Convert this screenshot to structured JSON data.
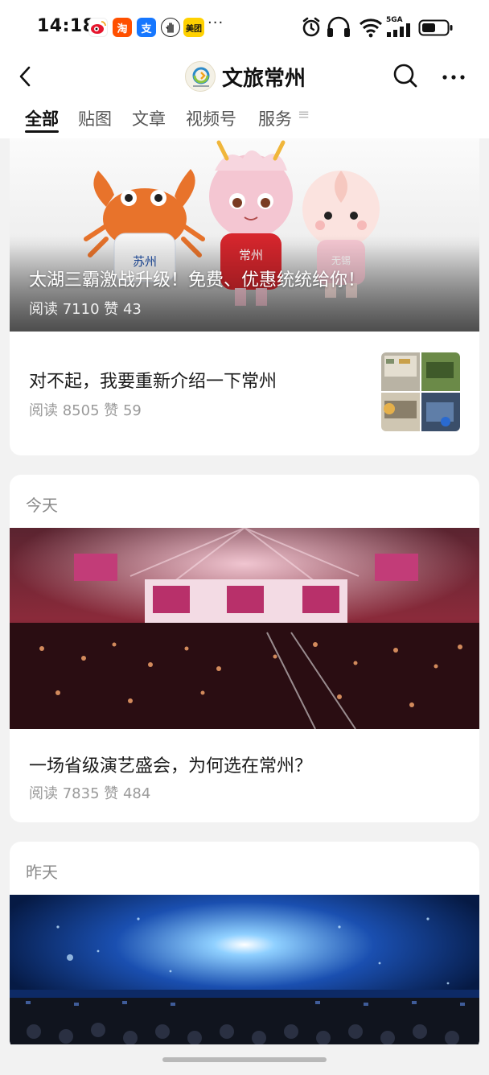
{
  "status_bar": {
    "time": "14:18",
    "app_icons": [
      {
        "name": "weibo-icon",
        "glyph": "微",
        "color": "#e6162d"
      },
      {
        "name": "taobao-icon",
        "glyph": "淘",
        "color": "#ff5000"
      },
      {
        "name": "alipay-icon",
        "glyph": "支",
        "color": "#1677ff"
      },
      {
        "name": "hand-icon",
        "glyph": "✋",
        "color": "#222222"
      },
      {
        "name": "meituan-icon",
        "glyph": "美团",
        "color": "#ffd100"
      }
    ],
    "more": "···",
    "network": "5GA"
  },
  "nav": {
    "title": "文旅常州",
    "avatar_icon": "wenlv-changzhou-logo"
  },
  "tabs": {
    "items": [
      "全部",
      "贴图",
      "文章",
      "视频号",
      "服务"
    ],
    "active_index": 0
  },
  "feed": {
    "hero": {
      "title": "太湖三霸激战升级！免费、优惠统统给你！",
      "meta": "阅读 7110   赞 43",
      "badges": [
        "苏州",
        "常州",
        "无锡"
      ]
    },
    "row": {
      "title": "对不起，我要重新介绍一下常州",
      "meta": "阅读 8505   赞 59"
    },
    "today": {
      "label": "今天",
      "title": "一场省级演艺盛会，为何选在常州？",
      "meta": "阅读 7835   赞 484"
    },
    "yesterday": {
      "label": "昨天"
    }
  },
  "colors": {
    "accent": "#111111",
    "muted": "#9a9a9a",
    "background": "#f2f2f2"
  }
}
